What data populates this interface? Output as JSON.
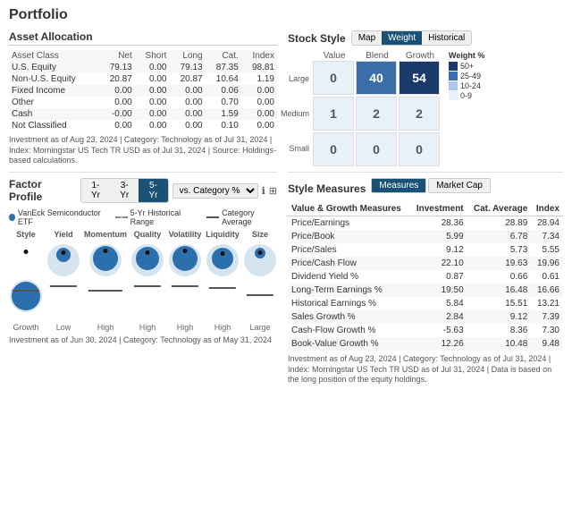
{
  "page": {
    "title": "Portfolio"
  },
  "assetAllocation": {
    "title": "Asset Allocation",
    "headers": [
      "Asset Class",
      "Net",
      "Short",
      "Long",
      "Cat.",
      "Index"
    ],
    "rows": [
      [
        "U.S. Equity",
        "79.13",
        "0.00",
        "79.13",
        "87.35",
        "98.81"
      ],
      [
        "Non-U.S. Equity",
        "20.87",
        "0.00",
        "20.87",
        "10.64",
        "1.19"
      ],
      [
        "Fixed Income",
        "0.00",
        "0.00",
        "0.00",
        "0.06",
        "0.00"
      ],
      [
        "Other",
        "0.00",
        "0.00",
        "0.00",
        "0.70",
        "0.00"
      ],
      [
        "Cash",
        "-0.00",
        "0.00",
        "0.00",
        "1.59",
        "0.00"
      ],
      [
        "Not Classified",
        "0.00",
        "0.00",
        "0.00",
        "0.10",
        "0.00"
      ]
    ],
    "note": "Investment as of Aug 23, 2024 | Category: Technology as of Jul 31, 2024 | Index: Morningstar US Tech TR USD as of Jul 31, 2024 | Source: Holdings-based calculations."
  },
  "stockStyle": {
    "title": "Stock Style",
    "tabs": [
      "Map",
      "Weight",
      "Historical"
    ],
    "activeTab": "Weight",
    "colHeaders": [
      "Value",
      "Blend",
      "Growth"
    ],
    "rowHeaders": [
      "Large",
      "Medium",
      "Small"
    ],
    "cells": [
      [
        0,
        40,
        54
      ],
      [
        1,
        2,
        2
      ],
      [
        0,
        0,
        0
      ]
    ],
    "legend": {
      "title": "Weight %",
      "items": [
        {
          "label": "50+",
          "color": "#1a3a6b"
        },
        {
          "label": "25-49",
          "color": "#3a6ea8"
        },
        {
          "label": "10-24",
          "color": "#aec6e8"
        },
        {
          "label": "0-9",
          "color": "#e8f0f8"
        }
      ]
    }
  },
  "factorProfile": {
    "title": "Factor Profile",
    "tabs": [
      "1-Yr",
      "3-Yr",
      "5-Yr"
    ],
    "activeTab": "5-Yr",
    "selectLabel": "vs. Category %",
    "legend": [
      {
        "type": "dot",
        "label": "VanEck Semiconductor ETF"
      },
      {
        "type": "dash",
        "label": "5-Yr Historical Range"
      },
      {
        "type": "line",
        "label": "Category Average"
      }
    ],
    "columns": [
      {
        "label": "Style",
        "sub": "Growth"
      },
      {
        "label": "Yield",
        "sub": "Low"
      },
      {
        "label": "Momentum",
        "sub": "High"
      },
      {
        "label": "Quality",
        "sub": "High"
      },
      {
        "label": "Volatility",
        "sub": "High"
      },
      {
        "label": "Liquidity",
        "sub": "High"
      },
      {
        "label": "Size",
        "sub": "Large"
      }
    ],
    "note": "Investment as of Jun 30, 2024 | Category: Technology as of May 31, 2024"
  },
  "styleMeasures": {
    "title": "Style Measures",
    "tabs": [
      "Measures",
      "Market Cap"
    ],
    "activeTab": "Measures",
    "headers": [
      "Value & Growth Measures",
      "Investment",
      "Cat. Average",
      "Index"
    ],
    "rows": [
      [
        "Price/Earnings",
        "28.36",
        "28.89",
        "28.94"
      ],
      [
        "Price/Book",
        "5.99",
        "6.78",
        "7.34"
      ],
      [
        "Price/Sales",
        "9.12",
        "5.73",
        "5.55"
      ],
      [
        "Price/Cash Flow",
        "22.10",
        "19.63",
        "19.96"
      ],
      [
        "Dividend Yield %",
        "0.87",
        "0.66",
        "0.61"
      ],
      [
        "Long-Term Earnings %",
        "19.50",
        "16.48",
        "16.66"
      ],
      [
        "Historical Earnings %",
        "5.84",
        "15.51",
        "13.21"
      ],
      [
        "Sales Growth %",
        "2.84",
        "9.12",
        "7.39"
      ],
      [
        "Cash-Flow Growth %",
        "-5.63",
        "8.36",
        "7.30"
      ],
      [
        "Book-Value Growth %",
        "12.26",
        "10.48",
        "9.48"
      ]
    ],
    "note": "Investment as of Aug 23, 2024 | Category: Technology as of Jul 31, 2024 | Index: Morningstar US Tech TR USD as of Jul 31, 2024 | Data is based on the long position of the equity holdings."
  }
}
